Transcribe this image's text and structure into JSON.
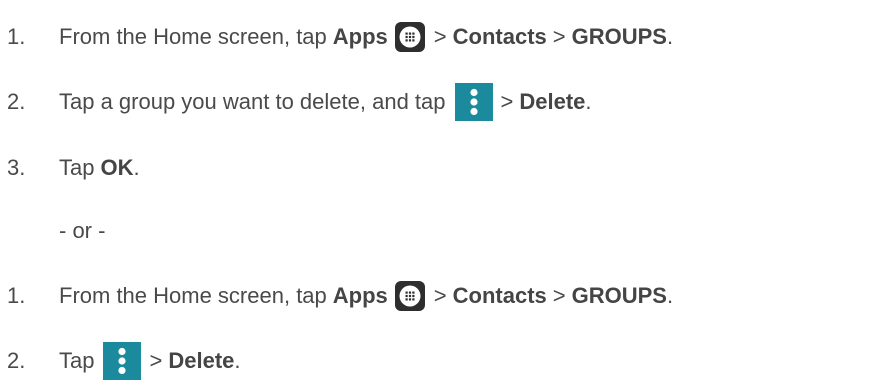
{
  "icons": {
    "apps": "apps-grid-icon",
    "menu": "overflow-menu-icon"
  },
  "colors": {
    "text": "#4a4a4a",
    "menu_icon_bg": "#1b8a9c",
    "apps_icon_bg": "#2e2e2e"
  },
  "method1": {
    "step1": {
      "num": "1.",
      "pre": "From the Home screen, tap",
      "apps": "Apps",
      "sep1": ">",
      "contacts": "Contacts",
      "sep2": ">",
      "groups": "GROUPS",
      "end": "."
    },
    "step2": {
      "num": "2.",
      "pre": "Tap a group you want to delete, and tap",
      "sep": ">",
      "delete": "Delete",
      "end": "."
    },
    "step3": {
      "num": "3.",
      "pre": "Tap",
      "ok": "OK",
      "end": "."
    }
  },
  "or_separator": "- or -",
  "method2": {
    "step1": {
      "num": "1.",
      "pre": "From the Home screen, tap",
      "apps": "Apps",
      "sep1": ">",
      "contacts": "Contacts",
      "sep2": ">",
      "groups": "GROUPS",
      "end": "."
    },
    "step2": {
      "num": "2.",
      "pre": "Tap",
      "sep": ">",
      "delete": "Delete",
      "end": "."
    }
  }
}
